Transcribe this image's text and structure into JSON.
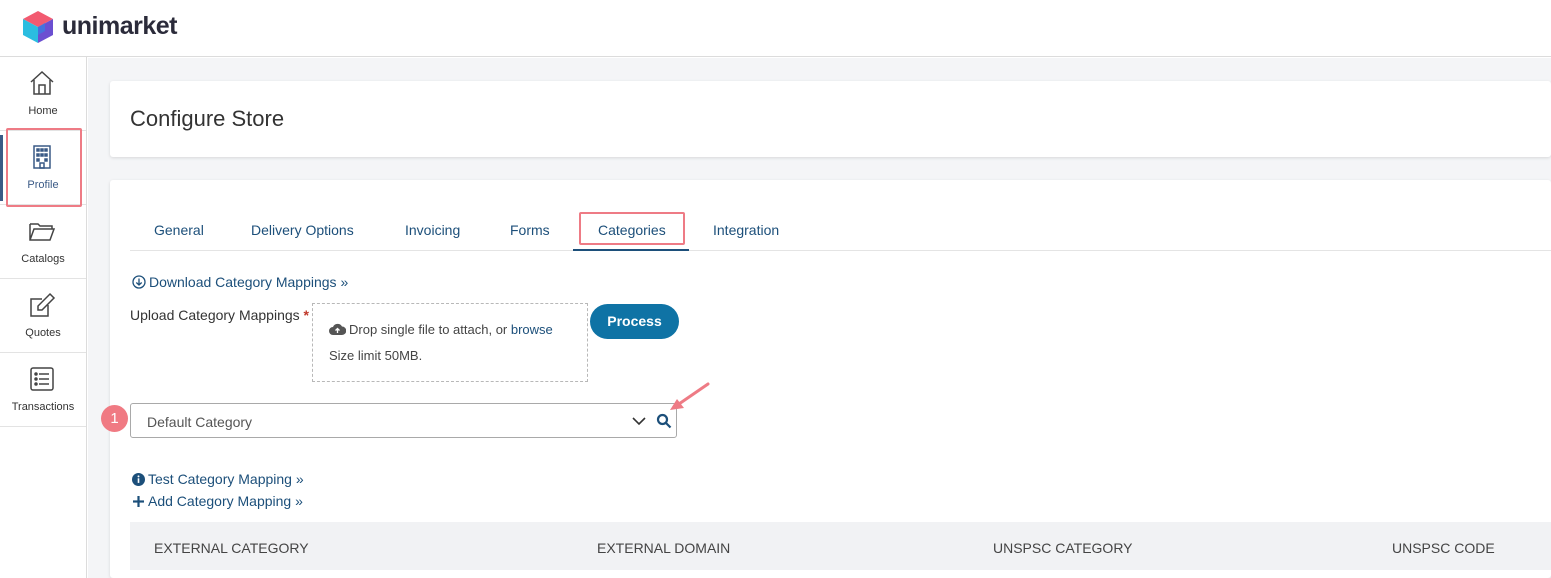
{
  "brand": {
    "name": "unimarket"
  },
  "sidebar": {
    "items": [
      {
        "label": "Home",
        "icon": "home-icon"
      },
      {
        "label": "Profile",
        "icon": "building-icon",
        "active": true
      },
      {
        "label": "Catalogs",
        "icon": "folder-icon"
      },
      {
        "label": "Quotes",
        "icon": "edit-icon"
      },
      {
        "label": "Transactions",
        "icon": "list-icon"
      }
    ]
  },
  "page": {
    "title": "Configure Store"
  },
  "tabs": [
    {
      "label": "General"
    },
    {
      "label": "Delivery Options"
    },
    {
      "label": "Invoicing"
    },
    {
      "label": "Forms"
    },
    {
      "label": "Categories",
      "active": true
    },
    {
      "label": "Integration"
    }
  ],
  "download_link": "Download Category Mappings »",
  "upload": {
    "label": "Upload Category Mappings",
    "required_mark": "*",
    "drop_text": "Drop single file to attach, or",
    "browse_label": "browse",
    "size_limit": "Size limit 50MB."
  },
  "process_button": "Process",
  "category_select": {
    "value": "Default Category"
  },
  "step_badge": "1",
  "test_link": "Test Category Mapping »",
  "add_link": "Add Category Mapping »",
  "table": {
    "columns": [
      "EXTERNAL CATEGORY",
      "EXTERNAL DOMAIN",
      "UNSPSC CATEGORY",
      "UNSPSC CODE"
    ]
  },
  "colors": {
    "accent": "#1c4f7a",
    "button": "#0f73a5",
    "annotation": "#ee7b85"
  }
}
